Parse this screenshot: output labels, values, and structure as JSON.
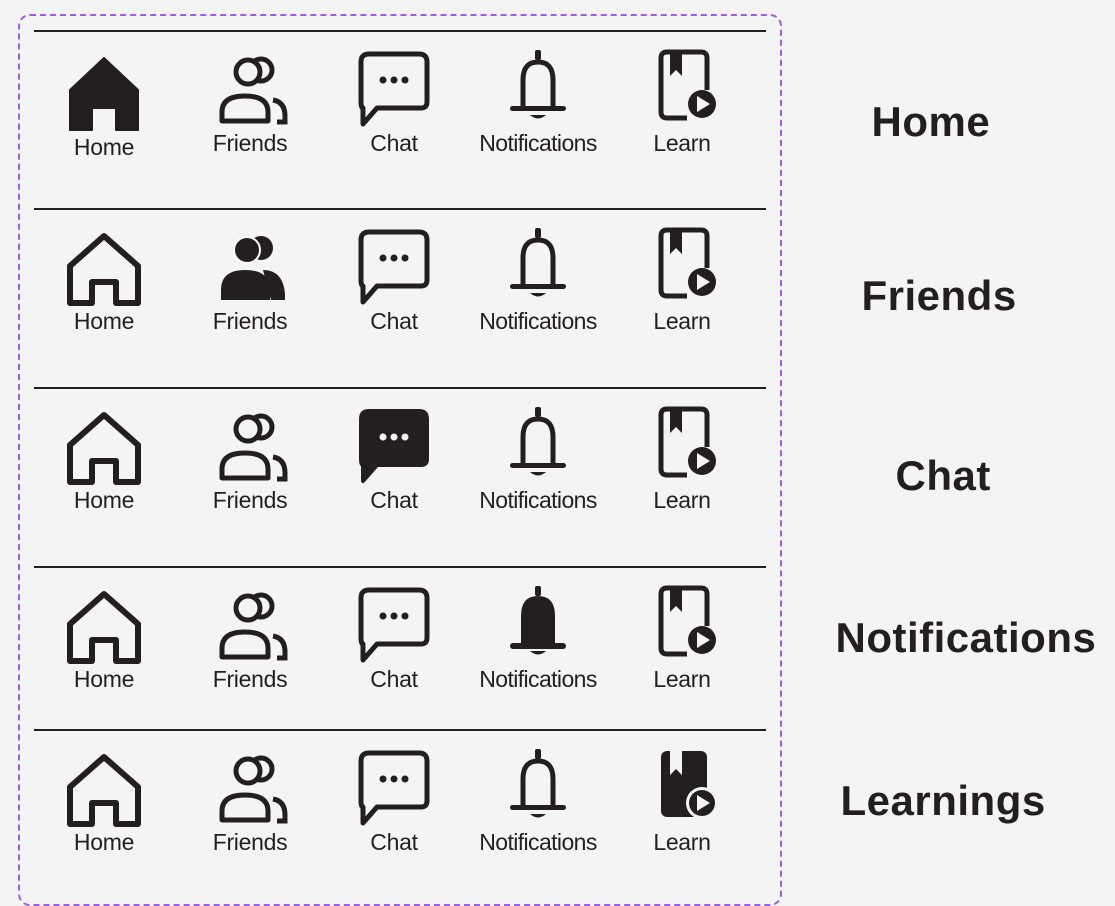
{
  "nav_items": [
    "Home",
    "Friends",
    "Chat",
    "Notifications",
    "Learn"
  ],
  "icon_names": [
    "home-icon",
    "friends-icon",
    "chat-icon",
    "bell-icon",
    "learn-icon"
  ],
  "rows": [
    {
      "title": "Home",
      "active_index": 0
    },
    {
      "title": "Friends",
      "active_index": 1
    },
    {
      "title": "Chat",
      "active_index": 2
    },
    {
      "title": "Notifications",
      "active_index": 3
    },
    {
      "title": "Learnings",
      "active_index": 4
    }
  ],
  "colors": {
    "icon": "#231f20",
    "accent_border": "#9b5cf0",
    "background": "#f4f4f4"
  }
}
